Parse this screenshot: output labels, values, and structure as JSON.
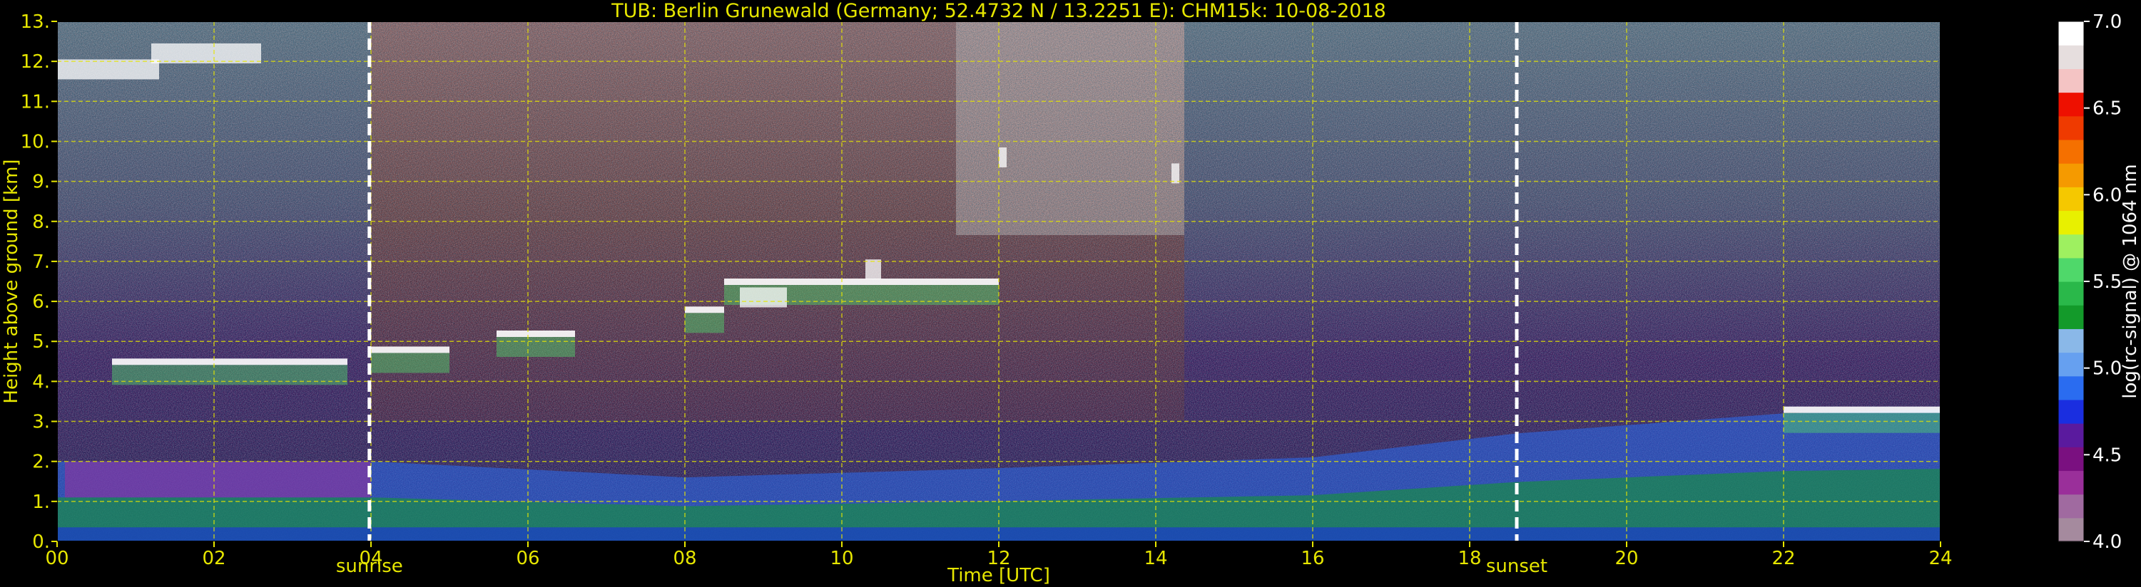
{
  "chart_data": {
    "type": "heatmap",
    "title": "TUB: Berlin Grunewald (Germany; 52.4732 N / 13.2251 E):    CHM15k: 10-08-2018",
    "xlabel": "Time [UTC]",
    "ylabel": "Height above ground [km]",
    "xlim": [
      0,
      24
    ],
    "ylim": [
      0,
      13
    ],
    "x_ticks": [
      "00",
      "02",
      "04",
      "06",
      "08",
      "10",
      "12",
      "14",
      "16",
      "18",
      "20",
      "22",
      "24"
    ],
    "y_ticks": [
      "0.",
      "1.",
      "2.",
      "3.",
      "4.",
      "5.",
      "6.",
      "7.",
      "8.",
      "9.",
      "10.",
      "11.",
      "12.",
      "13."
    ],
    "grid": true,
    "colorbar": {
      "label": "log(rc-signal) @ 1064 nm",
      "range": [
        4.0,
        7.0
      ],
      "ticks": [
        "4.0",
        "4.5",
        "5.0",
        "5.5",
        "6.0",
        "6.5",
        "7.0"
      ],
      "colors": [
        "#a58a9e",
        "#a06aa0",
        "#9a2f9a",
        "#7a1080",
        "#5a1a9e",
        "#1a2ee0",
        "#2a6cf0",
        "#66a0f0",
        "#8ab8e8",
        "#139a2a",
        "#2ab84a",
        "#4fd86a",
        "#9ef060",
        "#e8f000",
        "#f5c800",
        "#f59a00",
        "#f57000",
        "#ef3a00",
        "#ee1000",
        "#f4c4c4",
        "#e6dede",
        "#ffffff"
      ]
    },
    "markers": [
      {
        "label": "sunrise",
        "x": 3.98
      },
      {
        "label": "sunset",
        "x": 18.6
      }
    ],
    "features": {
      "boundary_layer_top_km": [
        {
          "x": 0.2,
          "y": 2.0
        },
        {
          "x": 4.0,
          "y": 2.0
        },
        {
          "x": 8.0,
          "y": 1.6
        },
        {
          "x": 11.5,
          "y": 1.8
        },
        {
          "x": 16.0,
          "y": 2.1
        },
        {
          "x": 18.6,
          "y": 2.7
        },
        {
          "x": 22.0,
          "y": 3.2
        },
        {
          "x": 24.0,
          "y": 3.3
        }
      ],
      "cloud_bands": [
        {
          "x0": 0.7,
          "x1": 3.7,
          "y": 4.5
        },
        {
          "x0": 4.0,
          "x1": 5.0,
          "y": 4.8
        },
        {
          "x0": 5.6,
          "x1": 6.6,
          "y": 5.2
        },
        {
          "x0": 8.0,
          "x1": 8.5,
          "y": 5.8
        },
        {
          "x0": 8.5,
          "x1": 12.0,
          "y": 6.5
        },
        {
          "x0": 22.0,
          "x1": 24.0,
          "y": 3.3
        }
      ]
    }
  }
}
